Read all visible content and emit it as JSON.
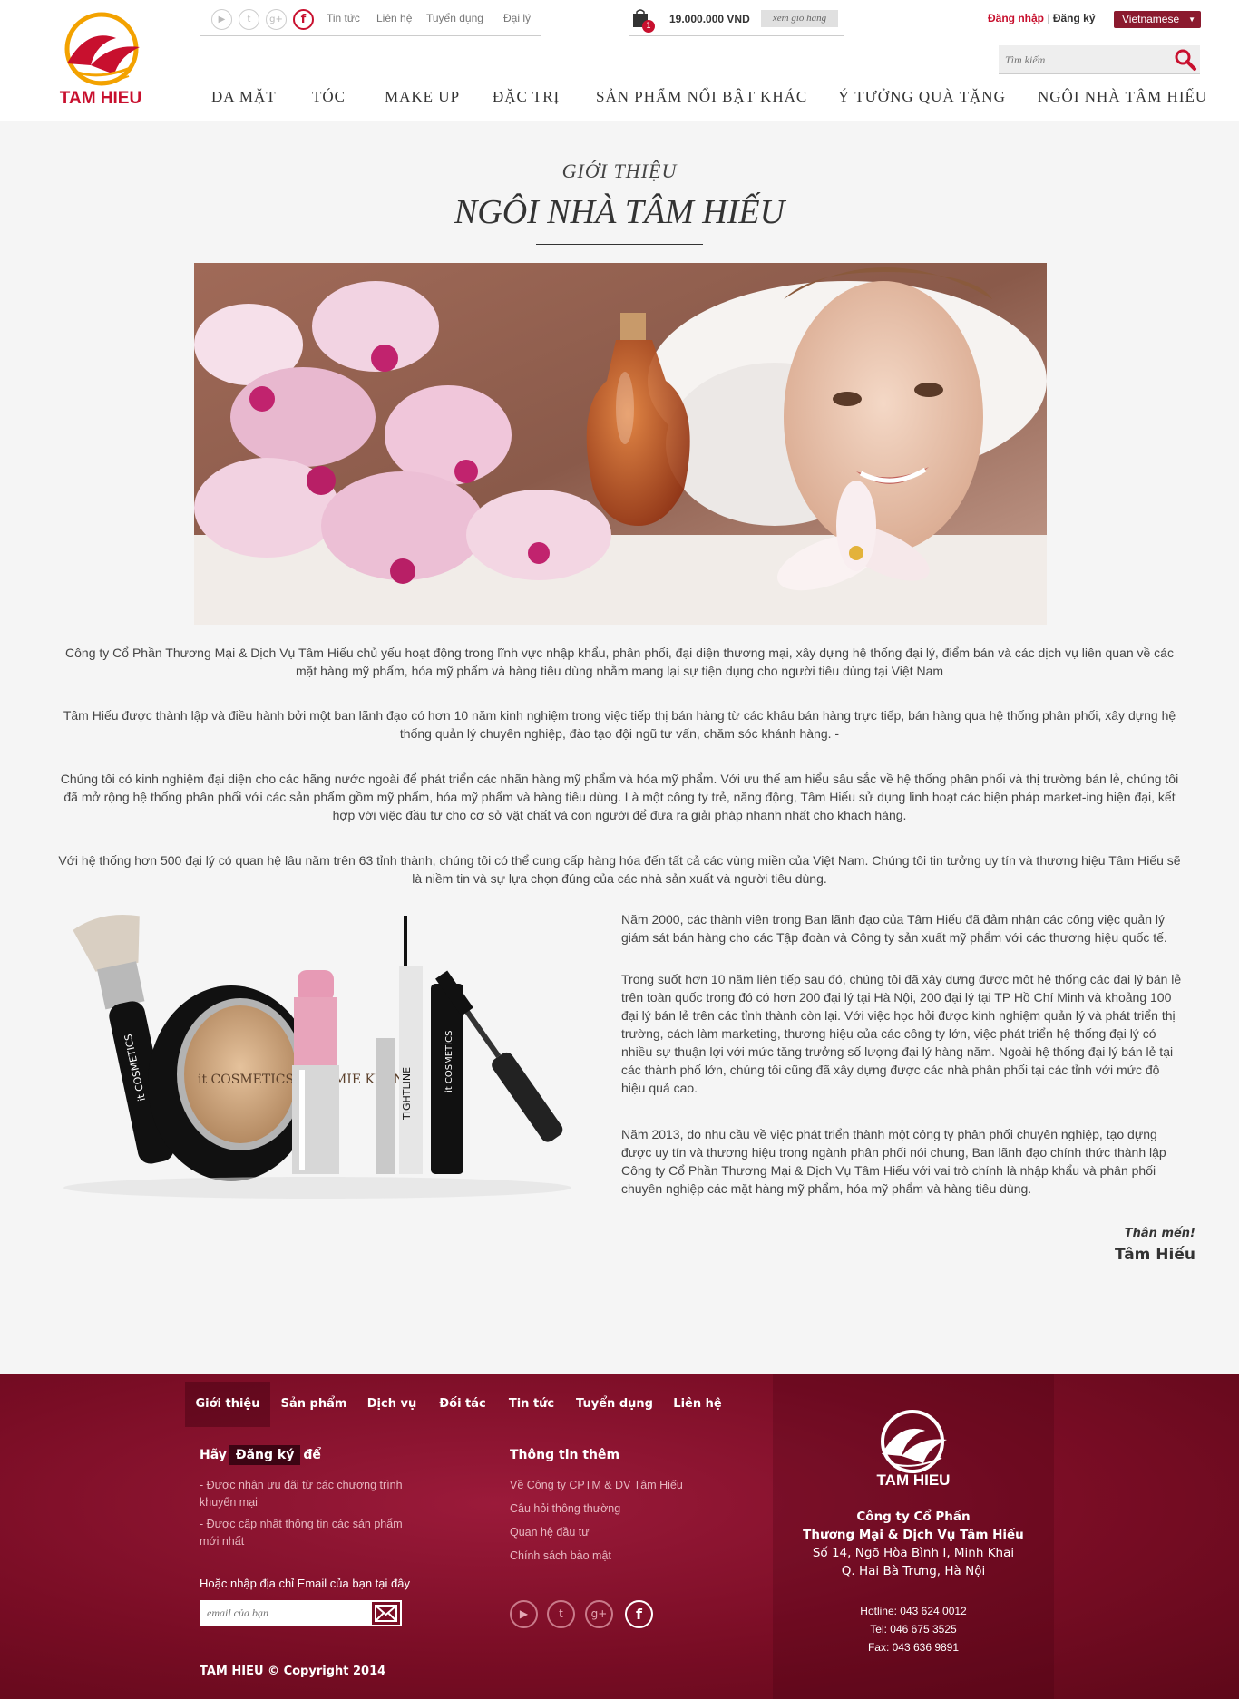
{
  "brand": {
    "name": "TAM HIEU"
  },
  "header": {
    "social": [
      "youtube-icon",
      "twitter-icon",
      "google-plus-icon",
      "facebook-icon"
    ],
    "top_links": [
      "Tin tức",
      "Liên hệ",
      "Tuyển dụng",
      "Đại lý"
    ],
    "cart": {
      "count": "1",
      "price": "19.000.000 VND",
      "view_label": "xem giỏ hàng"
    },
    "login_label": "Đăng nhập",
    "separator": "|",
    "register_label": "Đăng ký",
    "language": "Vietnamese",
    "search_placeholder": "Tìm kiếm"
  },
  "nav": [
    "DA MẶT",
    "TÓC",
    "MAKE UP",
    "ĐẶC TRỊ",
    "SẢN PHẨM NỔI BẬT KHÁC",
    "Ý TƯỞNG QUÀ TẶNG",
    "NGÔI NHÀ TÂM HIẾU"
  ],
  "main": {
    "subtitle": "GIỚI THIỆU",
    "title": "NGÔI NHÀ TÂM HIẾU",
    "paragraphs": [
      "Công ty Cổ Phần Thương Mại & Dịch Vụ Tâm Hiếu chủ yếu hoạt động trong lĩnh vực nhập khẩu, phân phối, đại diện thương mại, xây dựng hệ thống đại lý, điểm bán và các dịch vụ liên quan về các mặt hàng mỹ phẩm, hóa mỹ phẩm và hàng tiêu dùng nhằm mang lại sự tiện dụng cho người tiêu dùng tại Việt Nam",
      "Tâm Hiếu được thành lập và điều hành bởi một ban lãnh đạo có hơn 10 năm kinh nghiệm trong việc tiếp thị bán hàng từ các khâu bán hàng trực tiếp, bán hàng qua hệ thống phân phối, xây dựng hệ thống quản lý chuyên nghiệp, đào tạo đội ngũ tư vấn, chăm sóc khánh hàng. -",
      "Chúng tôi có kinh nghiệm đại diện cho các hãng nước ngoài để phát triển các nhãn hàng mỹ phẩm và hóa mỹ phẩm. Với ưu thế am hiểu sâu sắc về hệ thống phân phối và thị trường bán lẻ, chúng tôi đã mở rộng hệ thống phân phối với các sản phẩm gồm mỹ phẩm, hóa mỹ phẩm và hàng tiêu dùng. Là một công ty trẻ, năng động, Tâm Hiếu sử dụng linh hoạt các biện pháp market-ing hiện đại, kết hợp với việc đầu tư cho cơ sở vật chất và con người để đưa ra giải pháp nhanh nhất cho khách hàng.",
      "Với hệ thống hơn 500 đại lý có quan hệ lâu năm trên 63 tỉnh thành, chúng tôi có thể cung cấp hàng hóa đến tất cả các vùng miền của Việt Nam. Chúng tôi tin tưởng uy tín và thương hiệu Tâm Hiếu sẽ là niềm tin và sự lựa chọn đúng của các nhà sản xuất và người tiêu dùng."
    ],
    "right_paragraphs": [
      "Năm 2000, các thành viên trong Ban lãnh đạo của Tâm Hiếu đã đảm nhận các công việc quản lý giám sát bán hàng cho các Tập đoàn và Công ty sản xuất mỹ phẩm với các thương hiệu quốc tế.",
      "Trong suốt hơn 10 năm liên tiếp sau đó, chúng tôi đã xây dựng được một hệ thống các đại lý bán lẻ trên toàn quốc trong đó có hơn 200 đại lý tại Hà Nội, 200 đại lý tại TP Hồ Chí Minh và khoảng 100 đại lý bán lẻ trên các tỉnh thành còn lại. Với việc học hỏi được kinh nghiệm quản lý và phát triển thị trường, cách làm marketing, thương hiệu của các công ty lớn, việc phát triển hệ thống đại lý có nhiều sự thuận lợi với mức tăng trưởng số lượng đại lý hàng năm. Ngoài hệ thống đại lý bán lẻ tại các thành phố lớn, chúng tôi cũng đã xây dựng được các nhà phân phối tại các tỉnh với mức độ hiệu quả cao.",
      "Năm 2013, do nhu cầu về việc phát triển thành một công ty phân phối chuyên nghiệp, tạo dựng được uy tín và thương hiệu trong ngành phân phối nói chung, Ban lãnh đạo chính thức thành lập Công ty Cổ Phần Thương Mại & Dịch Vụ Tâm Hiếu với vai trò chính là nhập khẩu và phân phối chuyên nghiệp các mặt hàng mỹ phẩm, hóa mỹ phẩm và hàng tiêu dùng."
    ],
    "thanks": "Thân mến!",
    "signature": "Tâm Hiếu",
    "product_labels": [
      "it COSMETICS",
      "it COSMETICS BY JAMIE KERN",
      "TIGHTLINE",
      "it COSMETICS"
    ]
  },
  "footer": {
    "nav": [
      "Giới thiệu",
      "Sản phẩm",
      "Dịch vụ",
      "Đối tác",
      "Tin tức",
      "Tuyển dụng",
      "Liên hệ"
    ],
    "register_pre": "Hãy",
    "register_box": "Đăng ký",
    "register_post": "để",
    "benefits": [
      "- Được nhận ưu đãi từ các chương trình khuyến mại",
      "- Được cập nhật thông tin các sản phẩm mới nhất"
    ],
    "email_label": "Hoặc nhập địa chỉ Email của bạn tại đây",
    "email_placeholder": "email của bạn",
    "more_title": "Thông tin thêm",
    "more_links": [
      "Về Công ty CPTM & DV Tâm Hiếu",
      "Câu hỏi thông thường",
      "Quan hệ đầu tư",
      "Chính sách bảo mật"
    ],
    "social": [
      "youtube-icon",
      "twitter-icon",
      "google-plus-icon",
      "facebook-icon"
    ],
    "copyright": "TAM HIEU © Copyright 2014",
    "company": [
      "Công ty Cổ Phần",
      "Thương Mại & Dịch Vụ Tâm Hiếu"
    ],
    "address": [
      "Số 14, Ngõ Hòa Bình I, Minh Khai",
      "Q. Hai Bà Trưng, Hà Nội"
    ],
    "contacts": [
      "Hotline: 043 624 0012",
      "Tel: 046 675 3525",
      "Fax: 043 636 9891"
    ]
  },
  "colors": {
    "brand_red": "#c8102e",
    "footer_bg": "#7a0d25",
    "lang_bg": "#8b1a2e"
  }
}
